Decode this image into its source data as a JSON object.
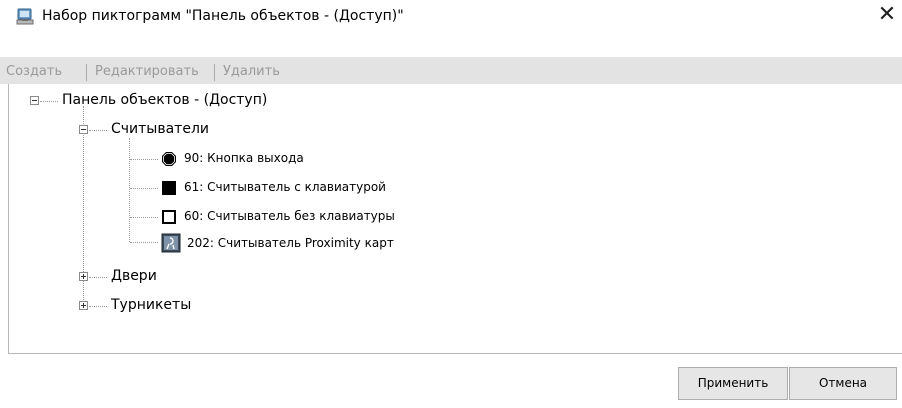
{
  "window": {
    "title": "Набор пиктограмм \"Панель объектов - (Доступ)\"",
    "close_glyph": "✕"
  },
  "toolbar": {
    "create_label": "Создать",
    "edit_label": "Редактировать",
    "delete_label": "Удалить"
  },
  "tree": {
    "root": {
      "label": "Панель объектов - (Доступ)",
      "expanded": true
    },
    "groups": [
      {
        "label": "Считыватели",
        "expanded": true,
        "items": [
          {
            "label": "90: Кнопка выхода",
            "icon": "exit-button-icon"
          },
          {
            "label": "61: Считыватель с клавиатурой",
            "icon": "filled-square-icon"
          },
          {
            "label": "60: Считыватель без клавиатуры",
            "icon": "empty-square-icon"
          },
          {
            "label": "202: Считыватель Proximity карт",
            "icon": "proximity-reader-icon"
          }
        ]
      },
      {
        "label": "Двери",
        "expanded": false
      },
      {
        "label": "Турникеты",
        "expanded": false
      }
    ]
  },
  "footer": {
    "apply_label": "Применить",
    "cancel_label": "Отмена"
  }
}
